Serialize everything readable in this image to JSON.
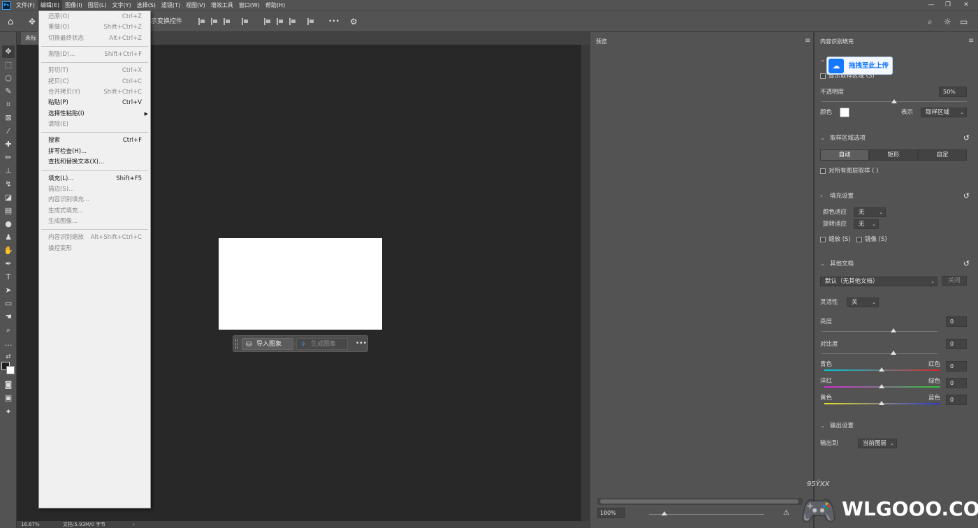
{
  "app": {
    "logo": "Ps"
  },
  "menubar": {
    "items": [
      "文件(F)",
      "编辑(E)",
      "图像(I)",
      "图层(L)",
      "文字(Y)",
      "选择(S)",
      "滤镜(T)",
      "视图(V)",
      "增效工具",
      "窗口(W)",
      "帮助(H)"
    ]
  },
  "window": {
    "minimize": "—",
    "restore": "❐",
    "close": "✕"
  },
  "optbar": {
    "transform_label": "示变换控件",
    "more": "•••"
  },
  "doc_tab": {
    "title": "未标"
  },
  "status": {
    "zoom": "16.67%",
    "doc_info": "文档:5.93M/0 字节"
  },
  "edit_menu": {
    "items": [
      {
        "label": "还原(O)",
        "shortcut": "Ctrl+Z"
      },
      {
        "label": "重做(O)",
        "shortcut": "Shift+Ctrl+Z"
      },
      {
        "label": "切换最终状态",
        "shortcut": "Alt+Ctrl+Z"
      },
      {
        "label": "渐隐(D)...",
        "shortcut": "Shift+Ctrl+F"
      },
      {
        "label": "剪切(T)",
        "shortcut": "Ctrl+X"
      },
      {
        "label": "拷贝(C)",
        "shortcut": "Ctrl+C"
      },
      {
        "label": "合并拷贝(Y)",
        "shortcut": "Shift+Ctrl+C"
      },
      {
        "label": "粘贴(P)",
        "shortcut": "Ctrl+V"
      },
      {
        "label": "选择性粘贴(I)",
        "shortcut": ""
      },
      {
        "label": "清除(E)",
        "shortcut": ""
      },
      {
        "label": "搜索",
        "shortcut": "Ctrl+F"
      },
      {
        "label": "拼写检查(H)...",
        "shortcut": ""
      },
      {
        "label": "查找和替换文本(X)...",
        "shortcut": ""
      },
      {
        "label": "填充(L)...",
        "shortcut": "Shift+F5"
      },
      {
        "label": "描边(S)...",
        "shortcut": ""
      },
      {
        "label": "内容识别填充...",
        "shortcut": ""
      },
      {
        "label": "生成式填充...",
        "shortcut": ""
      },
      {
        "label": "生成图像...",
        "shortcut": ""
      },
      {
        "label": "内容识别缩放",
        "shortcut": "Alt+Shift+Ctrl+C"
      },
      {
        "label": "操控变形",
        "shortcut": ""
      }
    ]
  },
  "context_bar": {
    "import_label": "导入图象",
    "generate_label": "生成图象",
    "more": "•••"
  },
  "preview_panel": {
    "tab": "预览",
    "zoom": "100%"
  },
  "caf_panel": {
    "tab": "内容识别填充",
    "sampling_overlay": "显示取样区域 (S)",
    "opacity_label": "不透明度",
    "opacity_value": "50%",
    "opacity_fraction": 0.5,
    "color_label": "颜色",
    "display_label": "表示",
    "display_value": "取样区域",
    "sampling_section": "取样区域选项",
    "seg_auto": "自动",
    "seg_rect": "矩形",
    "seg_custom": "自定",
    "sample_all_layers": "对所有图层取样 ( )",
    "fill_section": "填充设置",
    "color_adapt_label": "颜色适应",
    "color_adapt_value": "无",
    "rotate_adapt_label": "旋转适应",
    "rotate_adapt_value": "无",
    "scale_label": "缩放 (S)",
    "mirror_label": "镜像 (S)",
    "other_docs_section": "其他文档",
    "other_docs_value": "默认（无其他文档）",
    "close_button": "关闭",
    "flexibility_label": "灵活性",
    "flexibility_value": "关",
    "brightness_label": "亮度",
    "brightness_value": "0",
    "contrast_label": "对比度",
    "contrast_value": "0",
    "cyan_label": "青色",
    "red_label": "红色",
    "cyan_red_value": "0",
    "magenta_label": "洋红",
    "green_label": "绿色",
    "magenta_green_value": "0",
    "yellow_label": "黄色",
    "blue_label": "蓝色",
    "yellow_blue_value": "0",
    "output_section": "输出设置",
    "output_to_label": "输出到",
    "output_to_value": "当前图层"
  },
  "upload_badge": {
    "label": "拖拽至此上传"
  },
  "watermark": {
    "text": "WLGOOO.COM",
    "scribble": "95ŶXX"
  },
  "colors": {
    "panel": "#535353",
    "canvas": "#282828",
    "menu": "#f0f0f0",
    "accent": "#1677ff"
  }
}
